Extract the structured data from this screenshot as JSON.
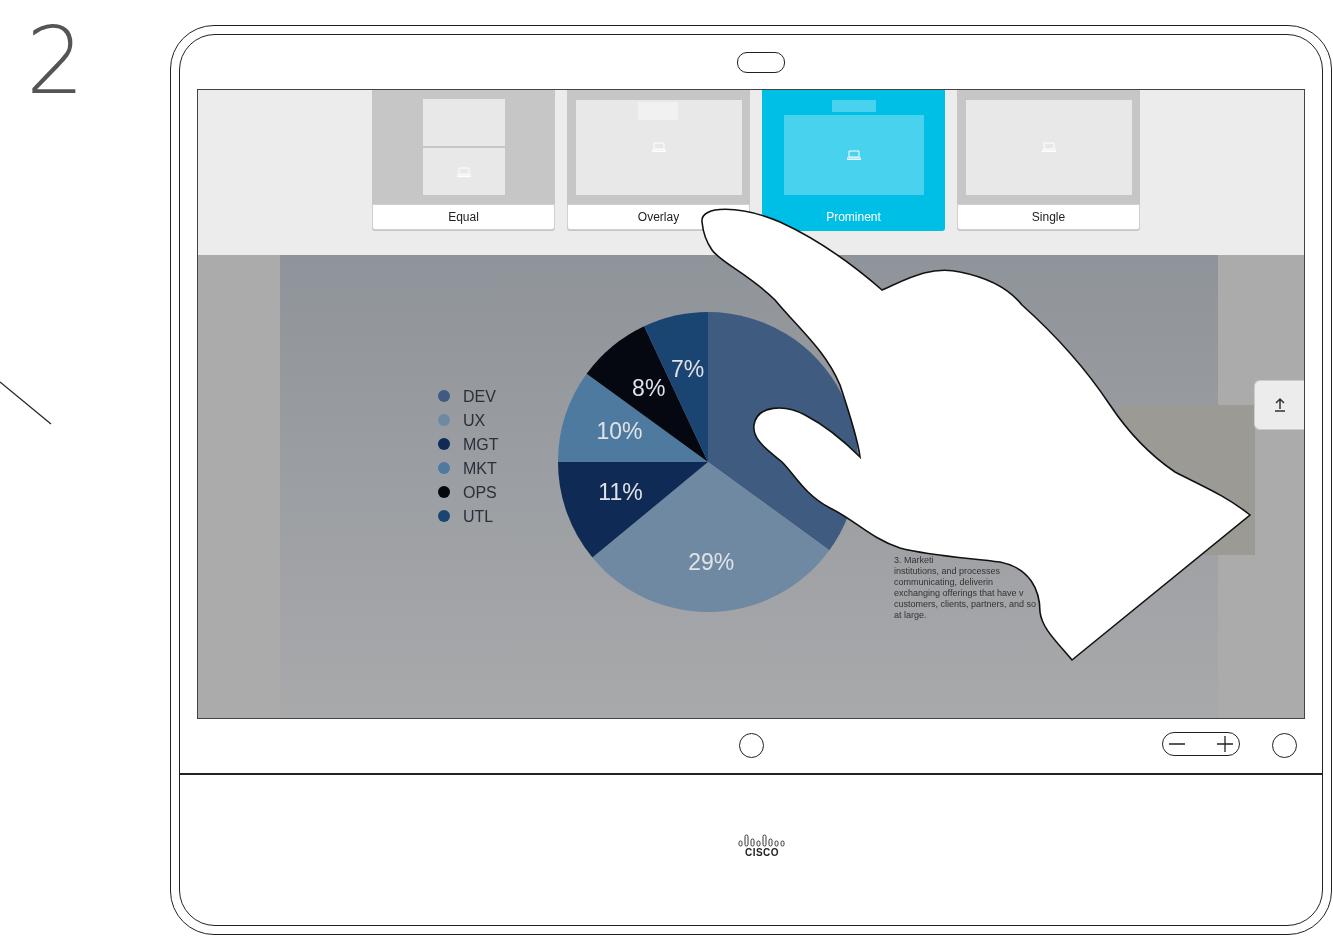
{
  "step": "2",
  "layout_picker": {
    "options": [
      {
        "label": "Equal",
        "kind": "equal",
        "selected": false
      },
      {
        "label": "Overlay",
        "kind": "overlay",
        "selected": false
      },
      {
        "label": "Prominent",
        "kind": "prominent",
        "selected": true
      },
      {
        "label": "Single",
        "kind": "single",
        "selected": false
      }
    ]
  },
  "slide": {
    "chart_data": {
      "type": "pie",
      "values": [
        35,
        29,
        11,
        10,
        8,
        7
      ],
      "categories": [
        "DEV",
        "UX",
        "MGT",
        "MKT",
        "OPS",
        "UTL"
      ],
      "colors": [
        "#3f5b80",
        "#7089a3",
        "#0f2b55",
        "#4f7aa0",
        "#050810",
        "#1a4472"
      ],
      "legend": true,
      "value_labels": [
        null,
        "29%",
        "11%",
        "10%",
        "8%",
        "7%"
      ]
    },
    "text_lines": [
      "3. Marketi",
      "institutions, and processes",
      "communicating, deliverin",
      "exchanging offerings that have v",
      "customers, clients, partners, and so",
      "at large."
    ]
  },
  "logo_text": "CISCO"
}
